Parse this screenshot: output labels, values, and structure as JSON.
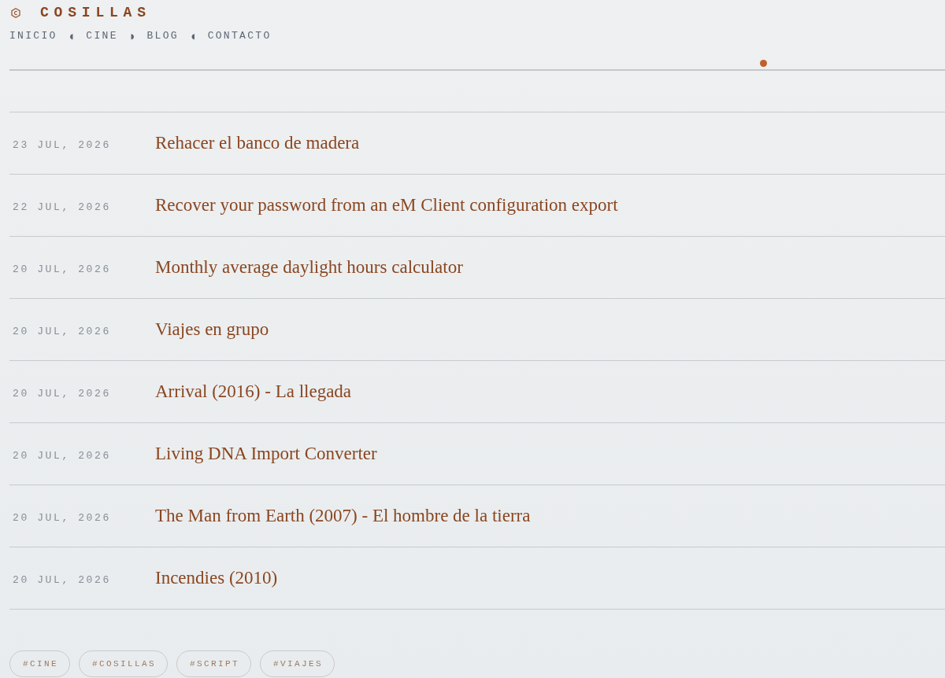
{
  "brand": {
    "title": "COSILLAS"
  },
  "nav": {
    "items": [
      {
        "label": "INICIO"
      },
      {
        "label": "CINE"
      },
      {
        "label": "BLOG"
      },
      {
        "label": "CONTACTO"
      }
    ],
    "separators": [
      "◖",
      "◗",
      "◖"
    ]
  },
  "posts": [
    {
      "date": "23 JUL, 2026",
      "title": "Rehacer el banco de madera"
    },
    {
      "date": "22 JUL, 2026",
      "title": "Recover your password from an eM Client configuration export"
    },
    {
      "date": "20 JUL, 2026",
      "title": "Monthly average daylight hours calculator"
    },
    {
      "date": "20 JUL, 2026",
      "title": "Viajes en grupo"
    },
    {
      "date": "20 JUL, 2026",
      "title": "Arrival (2016) - La llegada"
    },
    {
      "date": "20 JUL, 2026",
      "title": "Living DNA Import Converter"
    },
    {
      "date": "20 JUL, 2026",
      "title": "The Man from Earth (2007) - El hombre de la tierra"
    },
    {
      "date": "20 JUL, 2026",
      "title": "Incendies (2010)"
    }
  ],
  "tags": [
    "#CINE",
    "#COSILLAS",
    "#SCRIPT",
    "#VIAJES"
  ]
}
